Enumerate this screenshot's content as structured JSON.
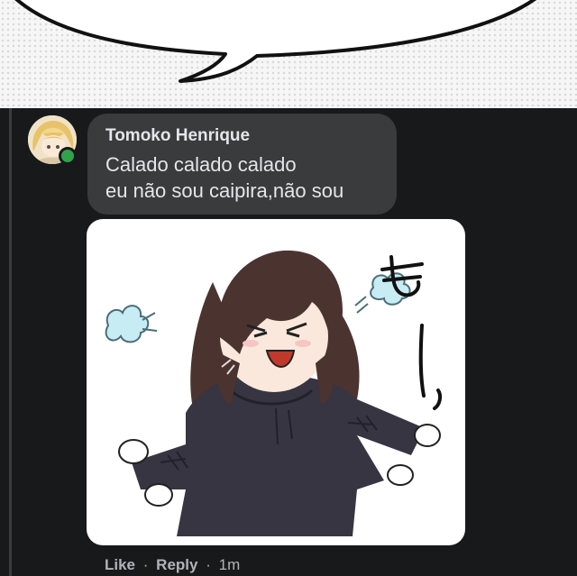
{
  "comment": {
    "author": "Tomoko Henrique",
    "lines": [
      "Calado calado calado",
      "eu não sou caipira,não sou"
    ],
    "online": true
  },
  "sticker": {
    "glyph": "も",
    "glyph_tail": "ー、"
  },
  "actions": {
    "like_label": "Like",
    "separator": "·",
    "reply_label": "Reply",
    "time": "1m"
  },
  "colors": {
    "background": "#18191a",
    "bubble": "#3a3b3c",
    "text": "#e4e6eb",
    "secondary_text": "#b0b3b8",
    "online": "#31a24c"
  }
}
